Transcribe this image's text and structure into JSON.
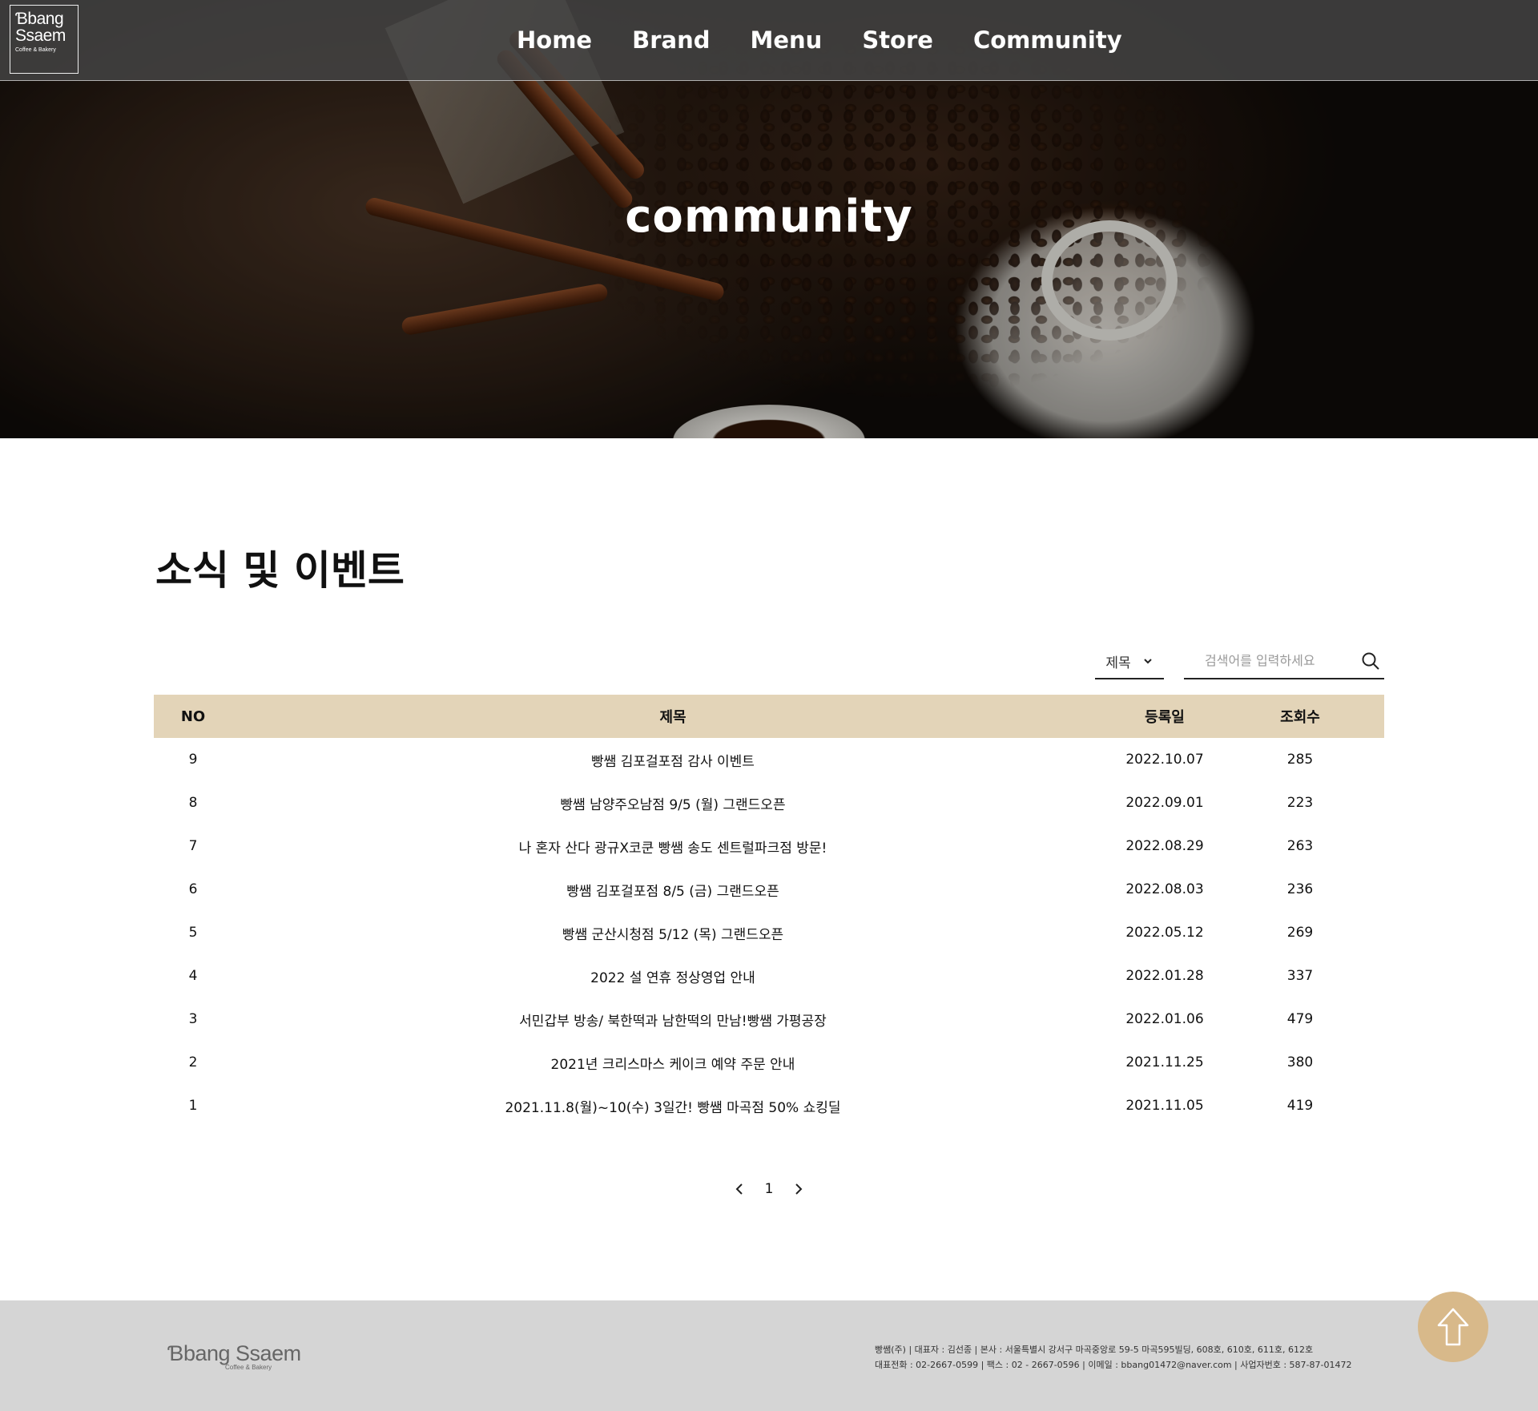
{
  "brand": {
    "logo_line1": "Ɓbang",
    "logo_line2": "Ssaem",
    "logo_tagline": "Coffee & Bakery"
  },
  "nav": {
    "items": [
      {
        "label": "Home"
      },
      {
        "label": "Brand"
      },
      {
        "label": "Menu"
      },
      {
        "label": "Store"
      },
      {
        "label": "Community"
      }
    ]
  },
  "hero": {
    "title": "community"
  },
  "section": {
    "title": "소식 및 이벤트"
  },
  "search": {
    "field_selected": "제목",
    "placeholder": "검색어를 입력하세요"
  },
  "board": {
    "headers": {
      "no": "NO",
      "title": "제목",
      "date": "등록일",
      "views": "조회수"
    },
    "rows": [
      {
        "no": "9",
        "title": "빵쌤 김포걸포점 감사 이벤트",
        "date": "2022.10.07",
        "views": "285"
      },
      {
        "no": "8",
        "title": "빵쌤 남양주오남점 9/5 (월) 그랜드오픈",
        "date": "2022.09.01",
        "views": "223"
      },
      {
        "no": "7",
        "title": "나 혼자 산다 광규X코쿤 빵쌤 송도 센트럴파크점 방문!",
        "date": "2022.08.29",
        "views": "263"
      },
      {
        "no": "6",
        "title": "빵쌤 김포걸포점 8/5 (금) 그랜드오픈",
        "date": "2022.08.03",
        "views": "236"
      },
      {
        "no": "5",
        "title": "빵쌤 군산시청점 5/12 (목) 그랜드오픈",
        "date": "2022.05.12",
        "views": "269"
      },
      {
        "no": "4",
        "title": "2022 설 연휴 정상영업 안내",
        "date": "2022.01.28",
        "views": "337"
      },
      {
        "no": "3",
        "title": "서민갑부 방송/ 북한떡과 남한떡의 만남!빵쌤 가평공장",
        "date": "2022.01.06",
        "views": "479"
      },
      {
        "no": "2",
        "title": "2021년 크리스마스 케이크 예약 주문 안내",
        "date": "2021.11.25",
        "views": "380"
      },
      {
        "no": "1",
        "title": "2021.11.8(월)~10(수) 3일간! 빵쌤 마곡점 50% 쇼킹딜",
        "date": "2021.11.05",
        "views": "419"
      }
    ]
  },
  "pagination": {
    "current": "1"
  },
  "footer": {
    "logo": "Ɓbang Ssaem",
    "logo_tagline": "Coffee & Bakery",
    "line1": "빵쌤(주) | 대표자 : 김선종 | 본사 : 서울특별시 강서구 마곡중앙로 59-5 마곡595빌딩, 608호, 610호, 611호, 612호",
    "line2": "대표전화 : 02-2667-0599 | 팩스 : 02 - 2667-0596 | 이메일 : bbang01472@naver.com | 사업자번호 : 587-87-01472"
  },
  "colors": {
    "table_header_bg": "#e3d4b8",
    "top_button_bg": "#d8b98a",
    "footer_bg": "#d5d5d5",
    "nav_bg": "#464646"
  },
  "icons": [
    "chevron-down-icon",
    "search-icon",
    "chevron-left-icon",
    "chevron-right-icon",
    "arrow-up-icon"
  ]
}
